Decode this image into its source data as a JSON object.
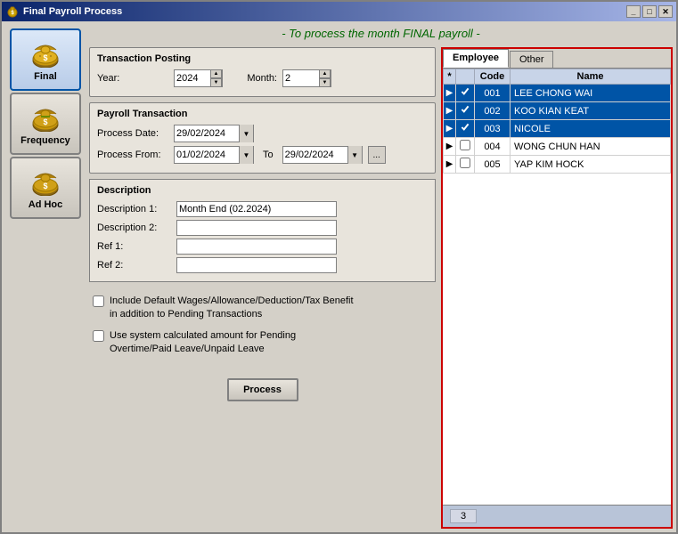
{
  "window": {
    "title": "Final Payroll Process",
    "title_icon": "$"
  },
  "page_title": "- To process the month FINAL payroll -",
  "transaction_posting": {
    "label": "Transaction Posting",
    "year_label": "Year:",
    "year_value": "2024",
    "month_label": "Month:",
    "month_value": "2"
  },
  "payroll_transaction": {
    "label": "Payroll Transaction",
    "process_date_label": "Process Date:",
    "process_date_value": "29/02/2024",
    "process_from_label": "Process From:",
    "process_from_value": "01/02/2024",
    "to_label": "To",
    "to_value": "29/02/2024"
  },
  "description": {
    "label": "Description",
    "desc1_label": "Description 1:",
    "desc1_value": "Month End (02.2024)",
    "desc2_label": "Description 2:",
    "desc2_value": "",
    "ref1_label": "Ref 1:",
    "ref1_value": "",
    "ref2_label": "Ref 2:",
    "ref2_value": ""
  },
  "checkboxes": {
    "include_wages_label": "Include Default Wages/Allowance/Deduction/Tax Benefit\nin addition to Pending Transactions",
    "use_calculated_label": "Use system calculated amount for Pending\nOvertime/Paid Leave/Unpaid Leave"
  },
  "process_button": "Process",
  "sidebar": {
    "items": [
      {
        "id": "final",
        "label": "Final",
        "active": true
      },
      {
        "id": "frequency",
        "label": "Frequency",
        "active": false
      },
      {
        "id": "adhoc",
        "label": "Ad Hoc",
        "active": false
      }
    ]
  },
  "employee_panel": {
    "tabs": [
      {
        "id": "employee",
        "label": "Employee",
        "active": true
      },
      {
        "id": "other",
        "label": "Other",
        "active": false
      }
    ],
    "table": {
      "headers": [
        "",
        "",
        "Code",
        "Name"
      ],
      "rows": [
        {
          "arrow": "▶",
          "checked": true,
          "code": "001",
          "name": "LEE CHONG WAI",
          "selected": true
        },
        {
          "arrow": "▶",
          "checked": true,
          "code": "002",
          "name": "KOO KIAN KEAT",
          "selected": true
        },
        {
          "arrow": "▶",
          "checked": true,
          "code": "003",
          "name": "NICOLE",
          "selected": true
        },
        {
          "arrow": "▶",
          "checked": false,
          "code": "004",
          "name": "WONG CHUN HAN",
          "selected": false
        },
        {
          "arrow": "▶",
          "checked": false,
          "code": "005",
          "name": "YAP KIM HOCK",
          "selected": false
        }
      ]
    },
    "count": "3"
  }
}
